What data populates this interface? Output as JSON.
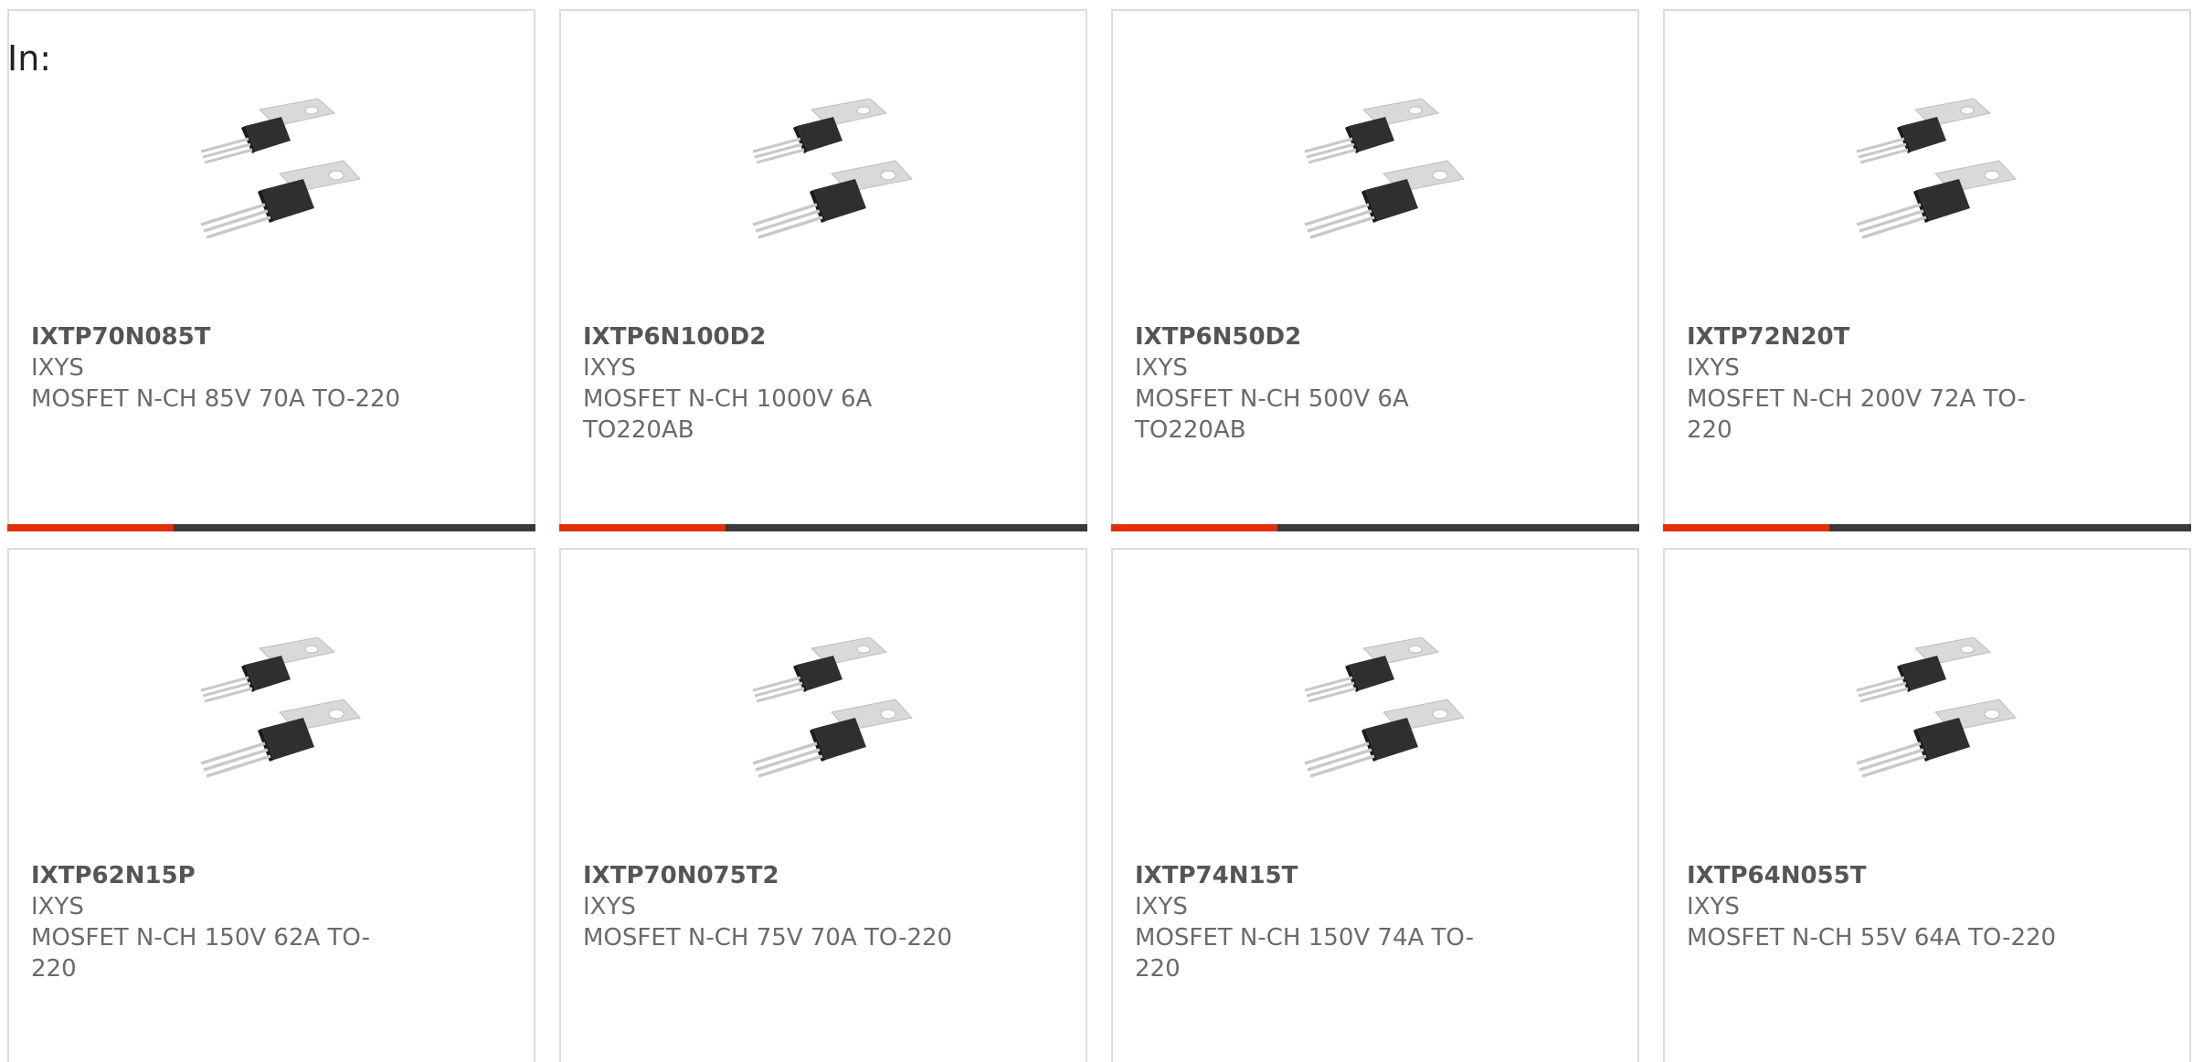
{
  "header": {
    "in_label": "In:"
  },
  "colors": {
    "accent": "#e0310c",
    "bar": "#3a3a3a",
    "border": "#dcdcdc",
    "text": "#6a6a6a"
  },
  "products": [
    {
      "part": "IXTP70N085T",
      "brand": "IXYS",
      "description": "MOSFET N-CH 85V 70A TO-220",
      "icon": "to220-transistor-icon"
    },
    {
      "part": "IXTP6N100D2",
      "brand": "IXYS",
      "description": "MOSFET N-CH 1000V 6A TO220AB",
      "icon": "to220-transistor-icon"
    },
    {
      "part": "IXTP6N50D2",
      "brand": "IXYS",
      "description": "MOSFET N-CH 500V 6A TO220AB",
      "icon": "to220-transistor-icon"
    },
    {
      "part": "IXTP72N20T",
      "brand": "IXYS",
      "description": "MOSFET N-CH 200V 72A TO-220",
      "icon": "to220-transistor-icon"
    },
    {
      "part": "IXTP62N15P",
      "brand": "IXYS",
      "description": "MOSFET N-CH 150V 62A TO-220",
      "icon": "to220-transistor-icon"
    },
    {
      "part": "IXTP70N075T2",
      "brand": "IXYS",
      "description": "MOSFET N-CH 75V 70A TO-220",
      "icon": "to220-transistor-icon"
    },
    {
      "part": "IXTP74N15T",
      "brand": "IXYS",
      "description": "MOSFET N-CH 150V 74A TO-220",
      "icon": "to220-transistor-icon"
    },
    {
      "part": "IXTP64N055T",
      "brand": "IXYS",
      "description": "MOSFET N-CH 55V 64A TO-220",
      "icon": "to220-transistor-icon"
    }
  ]
}
